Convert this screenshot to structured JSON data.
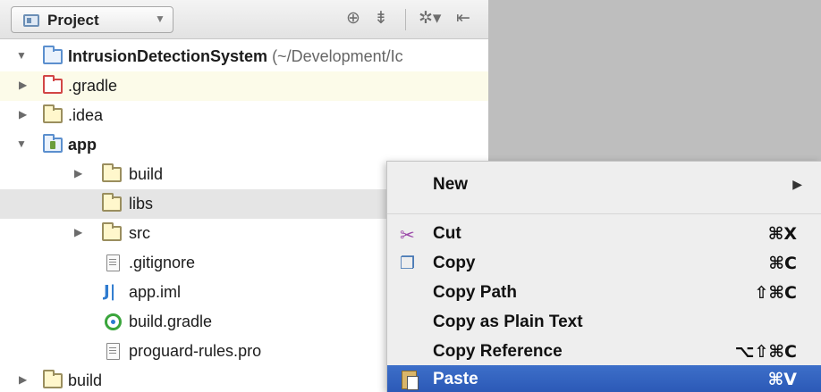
{
  "panel": {
    "view_selector": "Project",
    "toolbar_icons": [
      "target-icon",
      "collapse-all-icon",
      "settings-dropdown-icon",
      "hide-panel-icon"
    ]
  },
  "tree": {
    "root": {
      "name": "IntrusionDetectionSystem",
      "path_hint": "(~/Development/Ic"
    },
    "gradle_dir": ".gradle",
    "idea_dir": ".idea",
    "app_dir": "app",
    "app_build": "build",
    "app_libs": "libs",
    "app_src": "src",
    "gitignore": ".gitignore",
    "app_iml": "app.iml",
    "build_gradle": "build.gradle",
    "proguard": "proguard-rules.pro",
    "root_build": "build"
  },
  "context_menu": {
    "new": {
      "label": "New"
    },
    "cut": {
      "label": "Cut",
      "shortcut": "⌘X"
    },
    "copy": {
      "label": "Copy",
      "shortcut": "⌘C"
    },
    "copy_path": {
      "label": "Copy Path",
      "shortcut": "⇧⌘C"
    },
    "copy_plain": {
      "label": "Copy as Plain Text"
    },
    "copy_reference": {
      "label": "Copy Reference",
      "shortcut": "⌥⇧⌘C"
    },
    "paste": {
      "label": "Paste",
      "shortcut": "⌘V"
    }
  },
  "colors": {
    "selection": "#2d5bb8",
    "highlight_row": "#fcfbe9",
    "libs_row": "#e5e5e5",
    "editor_bg": "#bebebe"
  }
}
